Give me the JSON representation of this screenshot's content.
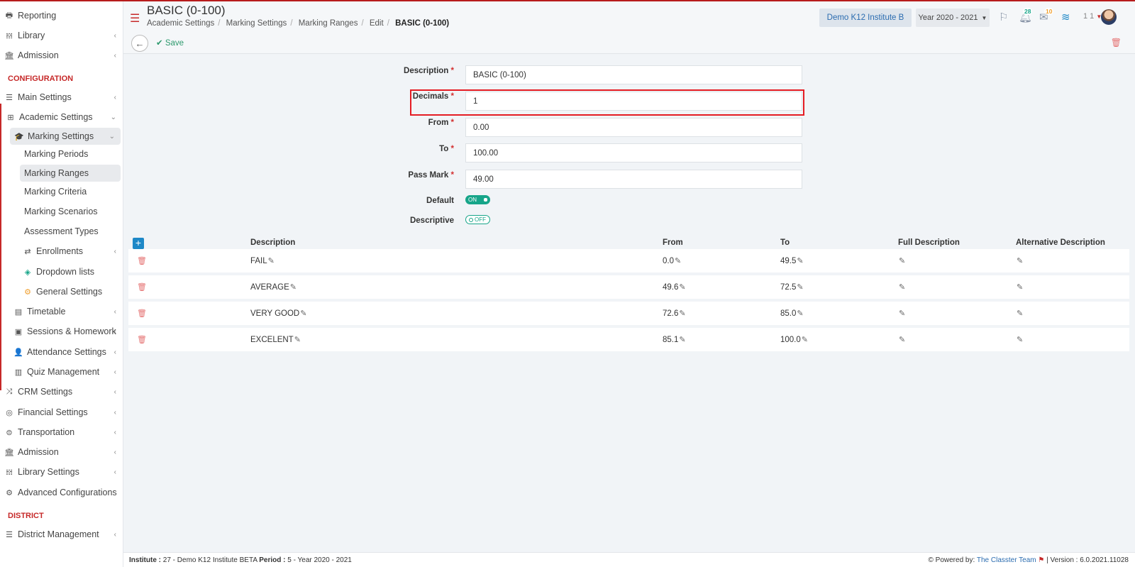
{
  "sidebar": {
    "items": [
      {
        "label": "Reporting",
        "icon": "printer-icon",
        "glyph": "🖶",
        "chevron": false
      },
      {
        "label": "Library",
        "icon": "books-icon",
        "glyph": "𝍍",
        "chevron": true
      },
      {
        "label": "Admission",
        "icon": "institution-icon",
        "glyph": "🏛",
        "chevron": true
      },
      {
        "label": "Main Settings",
        "icon": "sliders-icon",
        "glyph": "☰",
        "chevron": true
      },
      {
        "label": "Academic Settings",
        "icon": "sitemap-icon",
        "glyph": "⊞",
        "chevron": true
      },
      {
        "label": "Marking Settings",
        "icon": "graduation-cap-icon",
        "glyph": "🎓",
        "chevron": true
      },
      {
        "label": "Marking Periods",
        "icon": "",
        "glyph": "",
        "chevron": false
      },
      {
        "label": "Marking Ranges",
        "icon": "",
        "glyph": "",
        "chevron": false
      },
      {
        "label": "Marking Criteria",
        "icon": "",
        "glyph": "",
        "chevron": false
      },
      {
        "label": "Marking Scenarios",
        "icon": "",
        "glyph": "",
        "chevron": false
      },
      {
        "label": "Assessment Types",
        "icon": "",
        "glyph": "",
        "chevron": false
      },
      {
        "label": "Enrollments",
        "icon": "exchange-icon",
        "glyph": "⇄",
        "chevron": true
      },
      {
        "label": "Dropdown lists",
        "icon": "layers-icon",
        "glyph": "◈",
        "chevron": false
      },
      {
        "label": "General Settings",
        "icon": "cogs-icon",
        "glyph": "⚙",
        "chevron": false
      },
      {
        "label": "Timetable",
        "icon": "calendar-icon",
        "glyph": "▤",
        "chevron": true
      },
      {
        "label": "Sessions & Homework",
        "icon": "chalkboard-icon",
        "glyph": "▣",
        "chevron": true
      },
      {
        "label": "Attendance Settings",
        "icon": "user-check-icon",
        "glyph": "👤",
        "chevron": true
      },
      {
        "label": "Quiz Management",
        "icon": "file-icon",
        "glyph": "▥",
        "chevron": true
      },
      {
        "label": "CRM Settings",
        "icon": "random-icon",
        "glyph": "⤨",
        "chevron": true
      },
      {
        "label": "Financial Settings",
        "icon": "coins-icon",
        "glyph": "◎",
        "chevron": true
      },
      {
        "label": "Transportation",
        "icon": "bus-icon",
        "glyph": "⊜",
        "chevron": true
      },
      {
        "label": "Admission",
        "icon": "institution-icon",
        "glyph": "🏛",
        "chevron": true
      },
      {
        "label": "Library Settings",
        "icon": "books-icon",
        "glyph": "𝍍",
        "chevron": true
      },
      {
        "label": "Advanced Configurations",
        "icon": "cogs-icon",
        "glyph": "⚙",
        "chevron": false
      },
      {
        "label": "District Management",
        "icon": "list-icon",
        "glyph": "☰",
        "chevron": true
      }
    ],
    "section_configuration": "CONFIGURATION",
    "section_district": "DISTRICT"
  },
  "header": {
    "title": "BASIC (0-100)",
    "breadcrumb": [
      "Academic Settings",
      "Marking Settings",
      "Marking Ranges",
      "Edit",
      "BASIC (0-100)"
    ],
    "institute": "Demo K12 Institute B",
    "year": "Year 2020 - 2021",
    "notifications_count": "28",
    "messages_count": "10",
    "user": "1 1"
  },
  "toolbar": {
    "back_glyph": "←",
    "save_label": "Save"
  },
  "form": {
    "description_label": "Description",
    "description_value": "BASIC (0-100)",
    "decimals_label": "Decimals",
    "decimals_value": "1",
    "from_label": "From",
    "from_value": "0.00",
    "to_label": "To",
    "to_value": "100.00",
    "pass_mark_label": "Pass Mark",
    "pass_mark_value": "49.00",
    "default_label": "Default",
    "default_state": "ON",
    "descriptive_label": "Descriptive",
    "descriptive_state": "OFF"
  },
  "table": {
    "headers": [
      "Description",
      "From",
      "To",
      "Full Description",
      "Alternative Description"
    ],
    "rows": [
      {
        "description": "FAIL",
        "from": "0.0",
        "to": "49.5"
      },
      {
        "description": "AVERAGE",
        "from": "49.6",
        "to": "72.5"
      },
      {
        "description": "VERY GOOD",
        "from": "72.6",
        "to": "85.0"
      },
      {
        "description": "EXCELENT",
        "from": "85.1",
        "to": "100.0"
      }
    ]
  },
  "footer": {
    "institute_label": "Institute :",
    "institute_value": "27 - Demo K12 Institute BETA",
    "period_label": "Period :",
    "period_value": "5 - Year 2020 - 2021",
    "powered_by": "Powered by:",
    "team": "The Classter Team",
    "version": "| Version : 6.0.2021.11028"
  },
  "colors": {
    "accent_red": "#c62828",
    "toggle_green": "#17a589",
    "link_blue": "#2b6cb0"
  }
}
